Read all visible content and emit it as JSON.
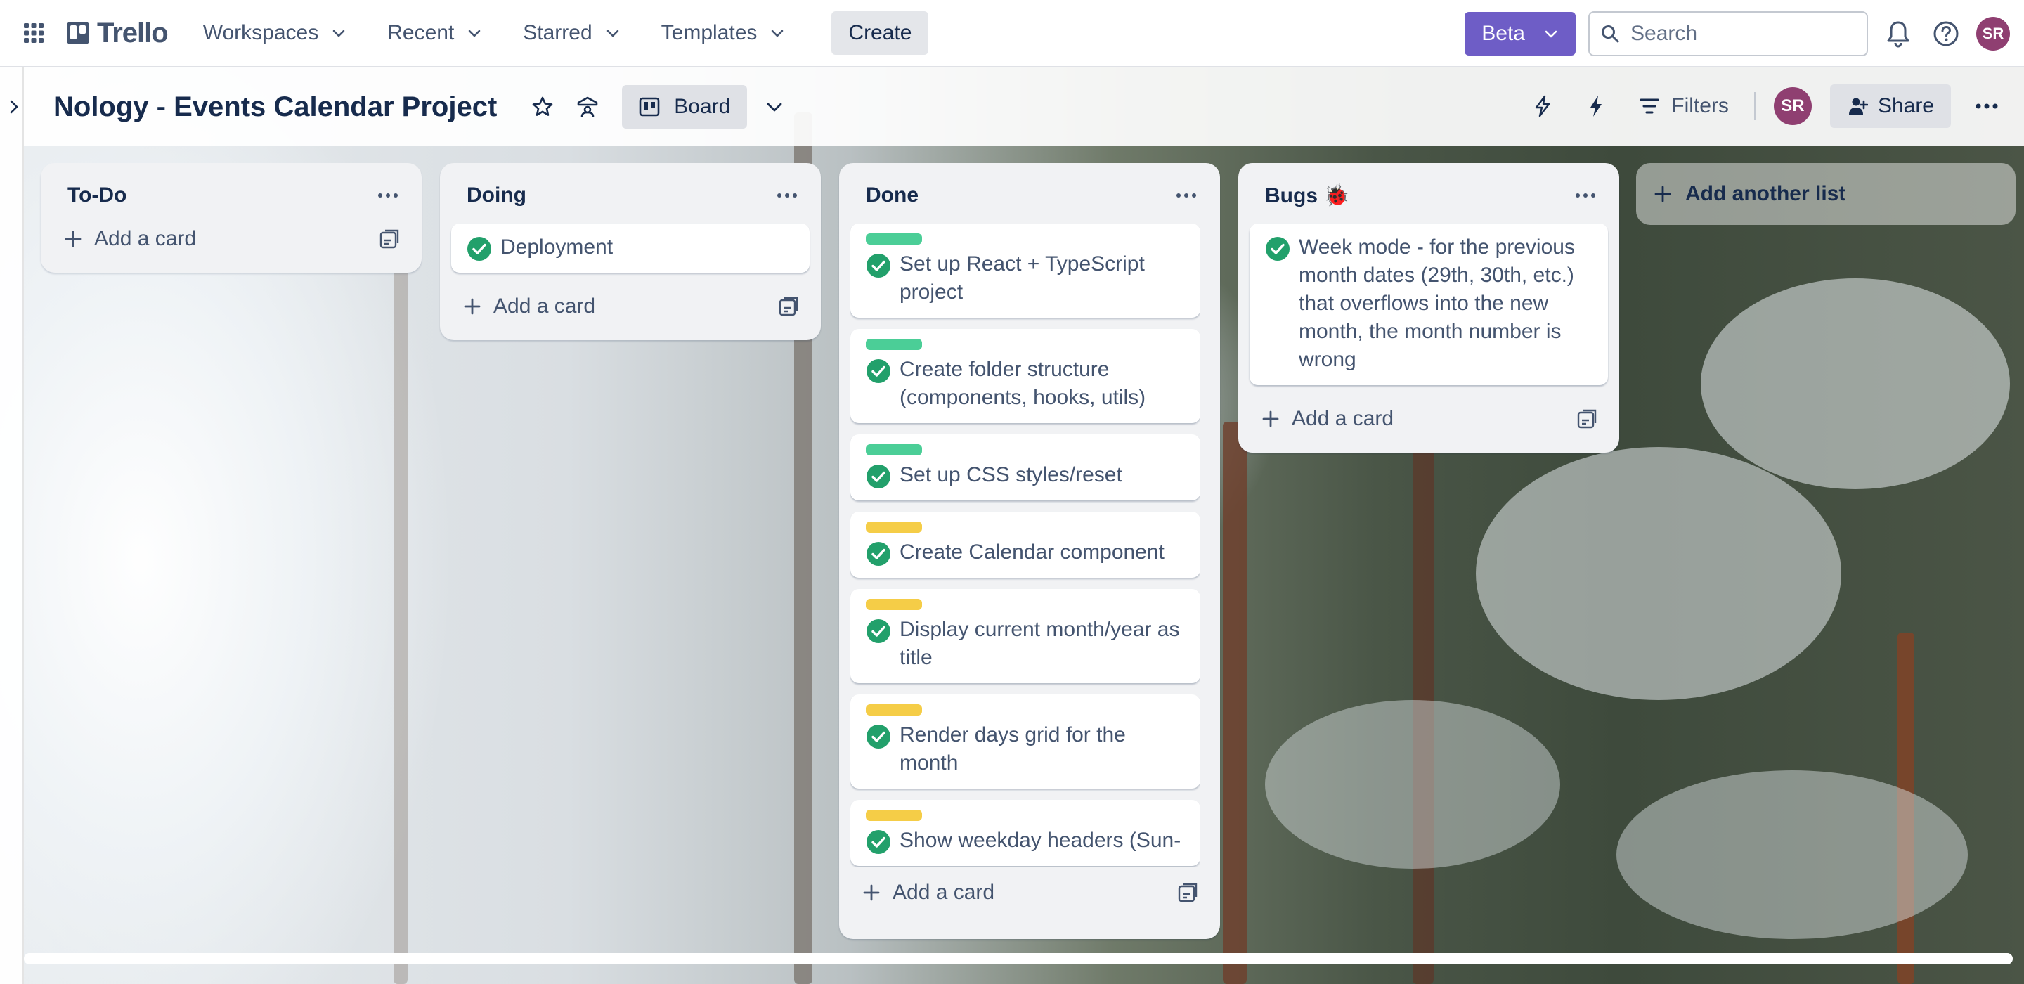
{
  "nav": {
    "logo": "Trello",
    "workspaces": "Workspaces",
    "recent": "Recent",
    "starred": "Starred",
    "templates": "Templates",
    "create": "Create",
    "beta": "Beta",
    "search_placeholder": "Search",
    "user_initials": "SR"
  },
  "board": {
    "title": "Nology - Events Calendar Project",
    "view": "Board",
    "filters": "Filters",
    "share": "Share",
    "member_initials": "SR",
    "add_another_list": "Add another list"
  },
  "colors": {
    "label_green": "#4bce97",
    "label_yellow": "#f5cd47",
    "check_green": "#22a06b",
    "beta_purple": "#6e5dc6"
  },
  "lists": {
    "todo": {
      "title": "To-Do",
      "add_card": "Add a card"
    },
    "doing": {
      "title": "Doing",
      "add_card": "Add a card",
      "cards": [
        "Deployment"
      ]
    },
    "done": {
      "title": "Done",
      "add_card": "Add a card",
      "cards": [
        {
          "title": "Set up React + TypeScript project",
          "label": "green"
        },
        {
          "title": "Create folder structure (components, hooks, utils)",
          "label": "green"
        },
        {
          "title": "Set up CSS styles/reset",
          "label": "green"
        },
        {
          "title": "Create Calendar component",
          "label": "yellow"
        },
        {
          "title": "Display current month/year as title",
          "label": "yellow"
        },
        {
          "title": "Render days grid for the month",
          "label": "yellow"
        },
        {
          "title": "Show weekday headers (Sun-",
          "label": "yellow"
        }
      ]
    },
    "bugs": {
      "title": "Bugs 🐞",
      "add_card": "Add a card",
      "cards": [
        "Week mode - for the previous month dates (29th, 30th, etc.) that overflows into the new month, the month number is wrong"
      ]
    }
  }
}
